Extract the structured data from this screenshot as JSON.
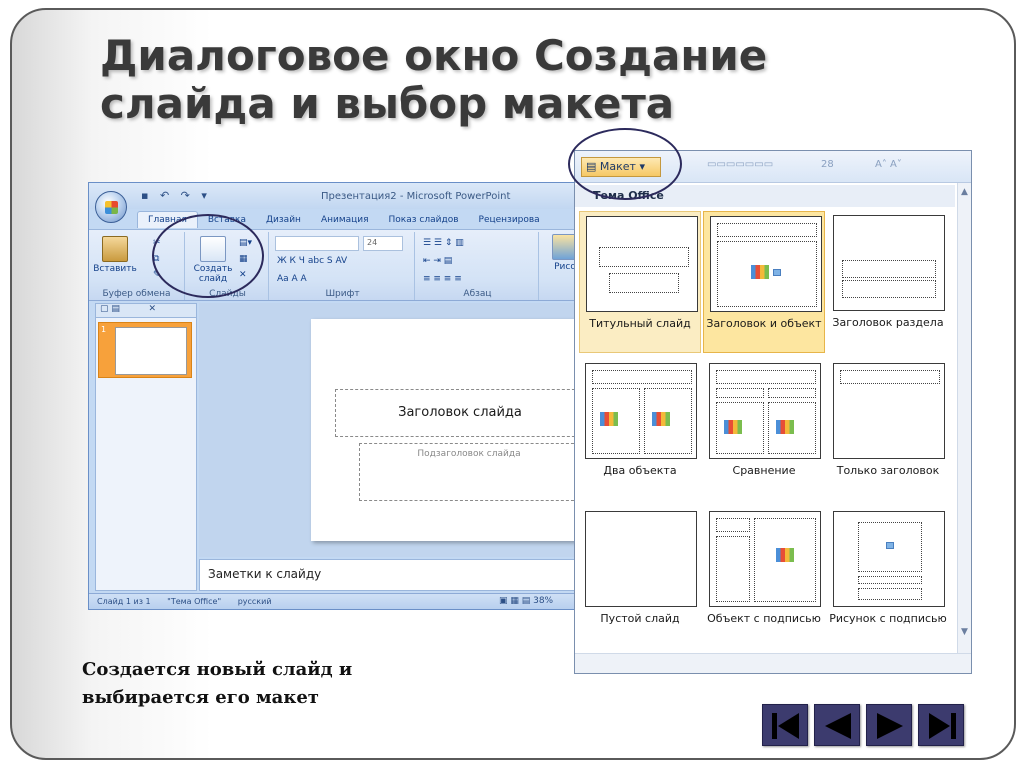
{
  "slide": {
    "title_line1": "Диалоговое окно Создание",
    "title_line2": "слайда и выбор макета",
    "caption_line1": "Создается новый слайд и",
    "caption_line2": "выбирается его макет"
  },
  "ppt": {
    "window_title": "Презентация2 - Microsoft PowerPoint",
    "tabs": [
      "Главная",
      "Вставка",
      "Дизайн",
      "Анимация",
      "Показ слайдов",
      "Рецензирова"
    ],
    "groups": {
      "clipboard": "Буфер обмена",
      "slides": "Слайды",
      "font": "Шрифт",
      "paragraph": "Абзац"
    },
    "buttons": {
      "paste": "Вставить",
      "new_slide_1": "Создать",
      "new_slide_2": "слайд",
      "picture": "Рисо"
    },
    "font_size": "24",
    "format_row": "Ж  К  Ч  abc  S  AV",
    "font_row2": "Aa  A  A",
    "slide_number": "1",
    "slide_title_placeholder": "Заголовок слайда",
    "slide_subtitle_placeholder": "Подзаголовок слайда",
    "notes": "Заметки к слайду",
    "status": {
      "slide": "Слайд 1 из 1",
      "theme": "\"Тема Office\"",
      "language": "русский",
      "zoom": "38%"
    }
  },
  "gallery": {
    "button": "Макет",
    "theme": "Тема Office",
    "font_size_ghost": "28",
    "layouts": [
      "Титульный слайд",
      "Заголовок и объект",
      "Заголовок раздела",
      "Два объекта",
      "Сравнение",
      "Только заголовок",
      "Пустой слайд",
      "Объект с подписью",
      "Рисунок с подписью"
    ]
  },
  "nav_icons": [
    "first-slide-icon",
    "previous-slide-icon",
    "next-slide-icon",
    "last-slide-icon"
  ],
  "colors": {
    "title": "#3a3a3a",
    "nav": "#3c3b6e",
    "selected_layout": "#fde6a0",
    "ribbon": "#d4e3f6"
  }
}
